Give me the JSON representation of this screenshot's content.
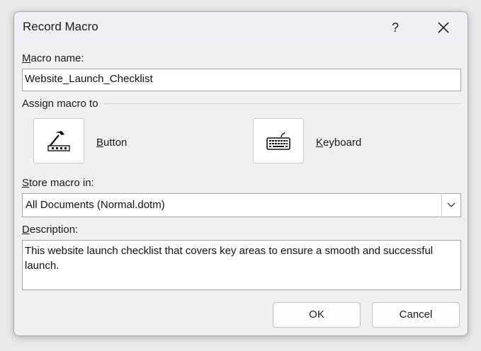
{
  "dialog": {
    "title": "Record Macro",
    "help_glyph": "?",
    "close_icon": "close-icon"
  },
  "macro_name": {
    "label_accel": "M",
    "label_rest": "acro name:",
    "value": "Website_Launch_Checklist"
  },
  "assign": {
    "label": "Assign macro to",
    "button": {
      "label_accel": "B",
      "label_rest": "utton",
      "icon": "toolbar-button-icon"
    },
    "keyboard": {
      "label_accel": "K",
      "label_rest": "eyboard",
      "icon": "keyboard-icon"
    }
  },
  "store": {
    "label_accel": "S",
    "label_rest": "tore macro in:",
    "selected": "All Documents (Normal.dotm)",
    "dropdown_icon": "chevron-down-icon"
  },
  "description": {
    "label_accel": "D",
    "label_rest": "escription:",
    "value": "This website launch checklist that covers key areas to ensure a smooth and successful launch."
  },
  "buttons": {
    "ok": "OK",
    "cancel": "Cancel"
  }
}
